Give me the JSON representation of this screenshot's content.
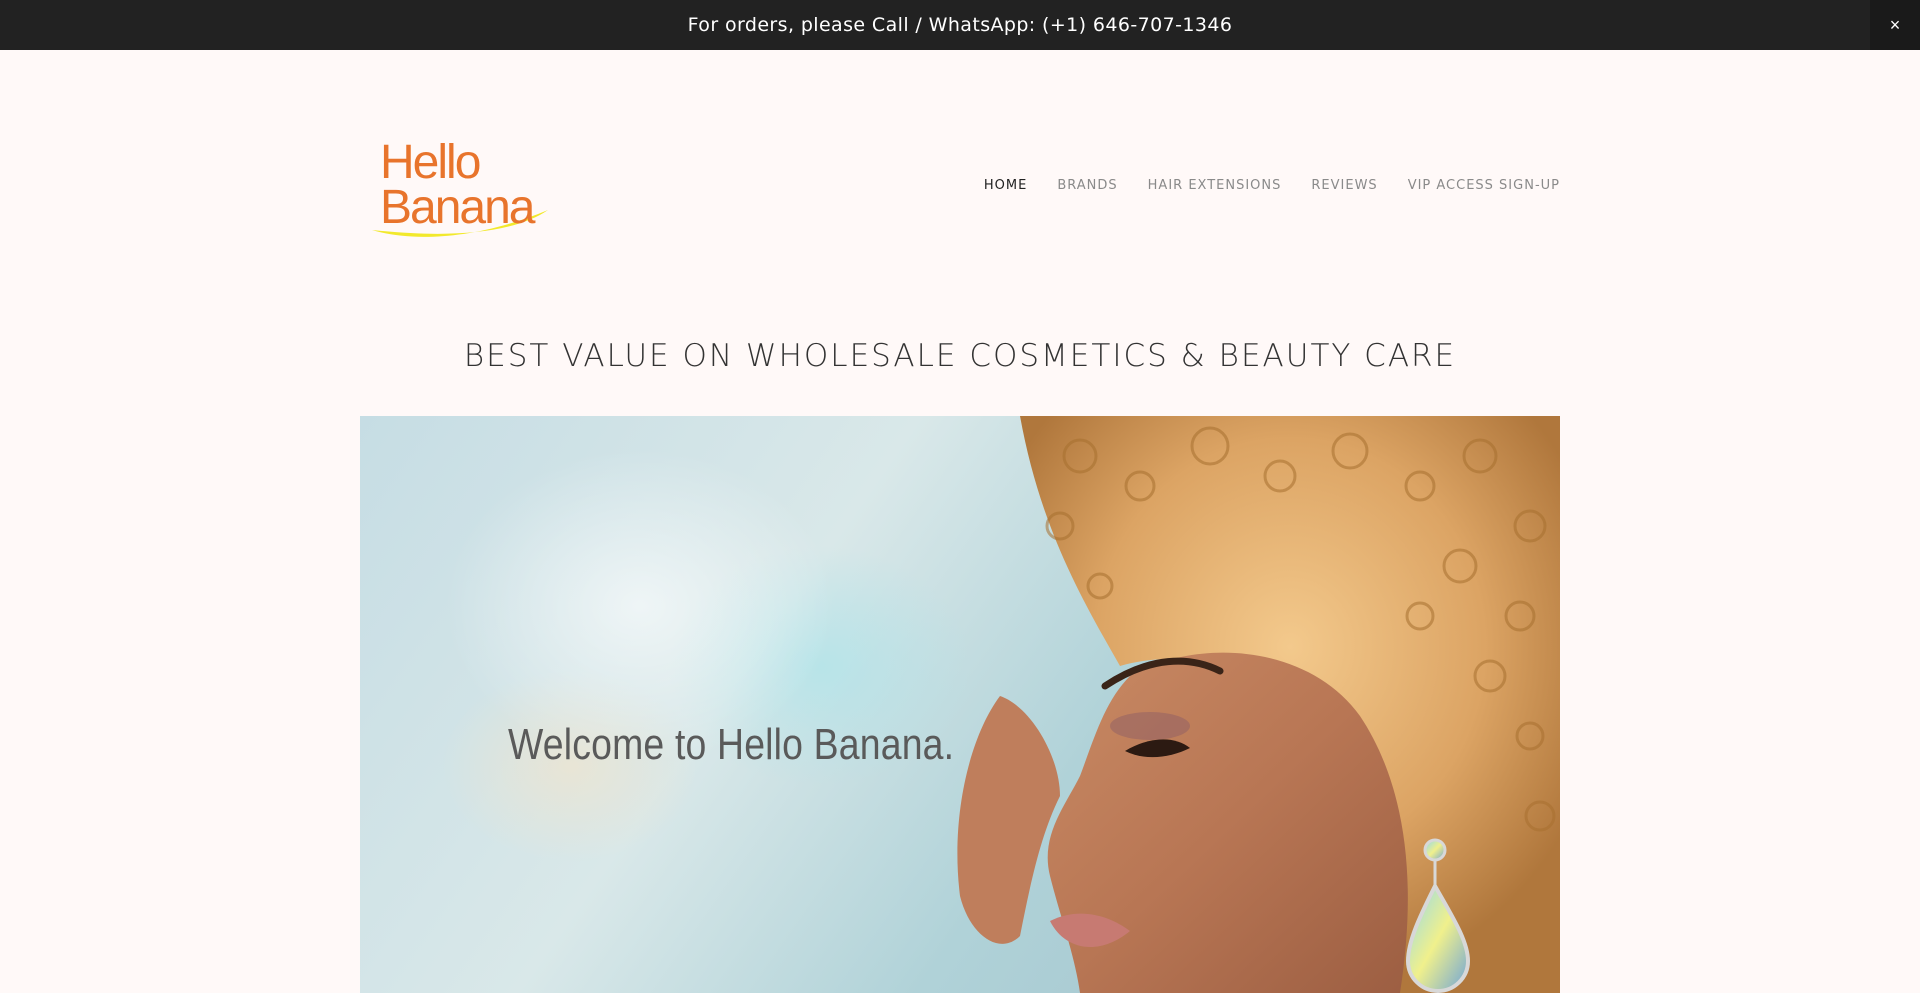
{
  "announcement": {
    "text": "For orders, please Call / WhatsApp: (+1) 646-707-1346",
    "close_label": "×"
  },
  "logo": {
    "line1": "Hello",
    "line2": "Banana",
    "colors": {
      "text": "#e8742c",
      "swoosh": "#f2e92c"
    }
  },
  "nav": {
    "items": [
      {
        "label": "HOME",
        "active": true
      },
      {
        "label": "BRANDS",
        "active": false
      },
      {
        "label": "HAIR EXTENSIONS",
        "active": false
      },
      {
        "label": "REVIEWS",
        "active": false
      },
      {
        "label": "VIP ACCESS SIGN-UP",
        "active": false
      }
    ]
  },
  "tagline": "BEST VALUE ON WHOLESALE COSMETICS & BEAUTY CARE",
  "hero": {
    "heading": "Welcome to Hello Banana."
  },
  "colors": {
    "page_bg": "#fff9f8",
    "banner_bg": "#222222",
    "nav_active": "#222222",
    "nav_inactive": "#8a8a8a"
  }
}
